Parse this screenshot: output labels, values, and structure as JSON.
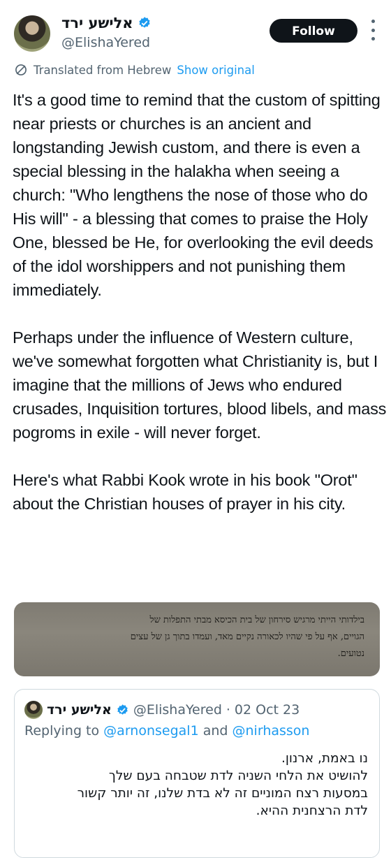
{
  "author": {
    "display_name": "אלישע ירד",
    "handle": "@ElishaYered",
    "verified": true,
    "follow_label": "Follow"
  },
  "translation": {
    "label": "Translated from Hebrew",
    "show_original": "Show original"
  },
  "tweet": {
    "paragraphs": [
      "It's a good time to remind that the custom of spitting near priests or churches is an ancient and longstanding Jewish custom, and there is even a special blessing in the halakha when seeing a church: \"Who lengthens the nose of those who do His will\" - a blessing that comes to praise the Holy One, blessed be He, for overlooking the evil deeds of the idol worshippers and not punishing them immediately.",
      "Perhaps under the influence of Western culture, we've somewhat forgotten what Christianity is, but I imagine that the millions of Jews who endured crusades, Inquisition tortures, blood libels, and mass pogroms in exile - will never forget.",
      "Here's what Rabbi Kook wrote in his book \"Orot\" about the Christian houses of prayer in his city."
    ]
  },
  "media": {
    "lines": [
      "בילדותי הייתי מרגיש סירחון של בית הכיסא מבתי התפלות של",
      "הגויים, אף על פי שהיו לכאורה נקיים מאד, ועמדו בתוך גן של עצים",
      "נטועים."
    ]
  },
  "quote": {
    "display_name": "אלישע ירד",
    "handle": "@ElishaYered",
    "dot": "·",
    "date": "02 Oct 23",
    "replying_prefix": "Replying to",
    "reply_to_1": "@arnonsegal1",
    "reply_and": "and",
    "reply_to_2": "@nirhasson",
    "lines": [
      "נו באמת, ארנון.",
      "להושיט את הלחי השניה לדת שטבחה בעם שלך",
      "במסעות רצח המוניים זה לא בדת שלנו, זה יותר קשור",
      "לדת הרצחנית ההיא."
    ]
  },
  "colors": {
    "accent": "#1d9bf0",
    "text": "#0f1419",
    "muted": "#536471",
    "follow_bg": "#0f1419"
  }
}
